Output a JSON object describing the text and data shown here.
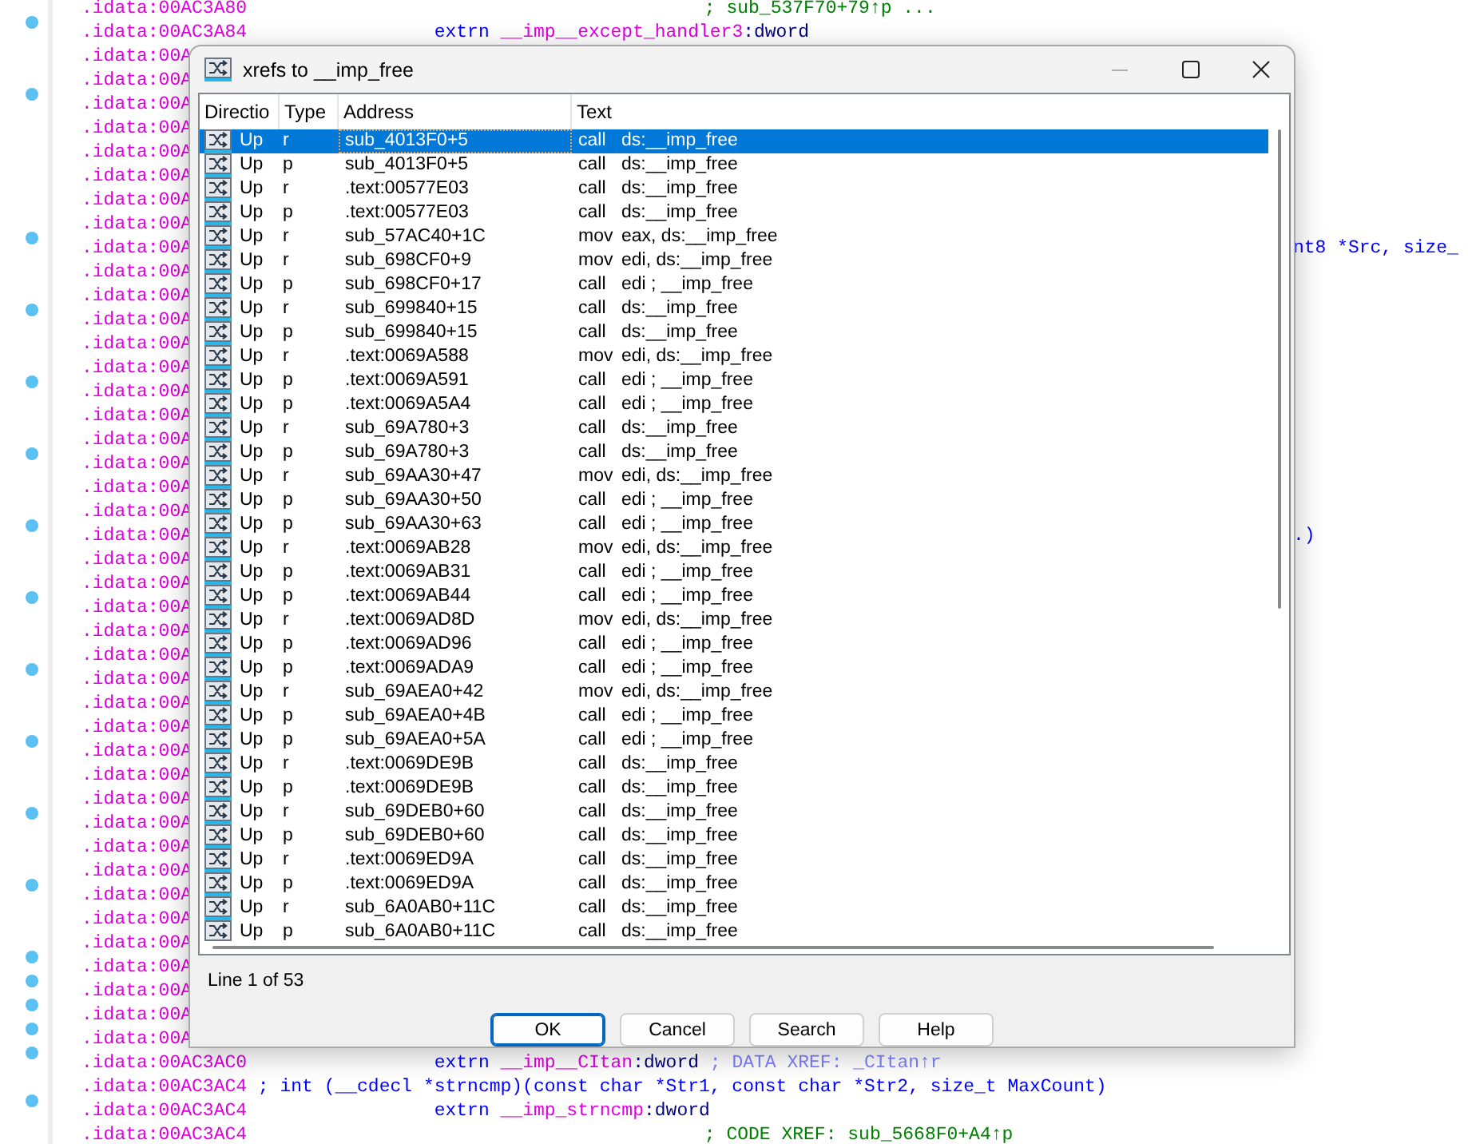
{
  "listing": [
    {
      "address": ".idata:00AC3A80",
      "marked": false,
      "parts": [
        {
          "text": "; sub_537F70+79↑p ...",
          "kind": "comment"
        }
      ]
    },
    {
      "address": ".idata:00AC3A84",
      "marked": true,
      "parts": [
        {
          "text": "extrn ",
          "kind": "keyword"
        },
        {
          "text": "__imp__except_handler3",
          "kind": "name"
        },
        {
          "text": ":dword",
          "kind": "type"
        }
      ]
    },
    {
      "address": ".idata:00A",
      "marked": false
    },
    {
      "address": ".idata:00A",
      "marked": false
    },
    {
      "address": ".idata:00A",
      "marked": true
    },
    {
      "address": ".idata:00A",
      "marked": false
    },
    {
      "address": ".idata:00A",
      "marked": false
    },
    {
      "address": ".idata:00A",
      "marked": false
    },
    {
      "address": ".idata:00A",
      "marked": false
    },
    {
      "address": ".idata:00A",
      "marked": false
    },
    {
      "address": ".idata:00A",
      "marked": true,
      "parts": [
        {
          "text": "nt8 *Src, size_",
          "kind": "tail"
        }
      ]
    },
    {
      "address": ".idata:00A",
      "marked": false
    },
    {
      "address": ".idata:00A",
      "marked": false
    },
    {
      "address": ".idata:00A",
      "marked": true
    },
    {
      "address": ".idata:00A",
      "marked": false
    },
    {
      "address": ".idata:00A",
      "marked": false
    },
    {
      "address": ".idata:00A",
      "marked": true
    },
    {
      "address": ".idata:00A",
      "marked": false
    },
    {
      "address": ".idata:00A",
      "marked": false
    },
    {
      "address": ".idata:00A",
      "marked": true
    },
    {
      "address": ".idata:00A",
      "marked": false
    },
    {
      "address": ".idata:00A",
      "marked": false
    },
    {
      "address": ".idata:00A",
      "marked": true,
      "parts": [
        {
          "text": ".)",
          "kind": "tail"
        }
      ]
    },
    {
      "address": ".idata:00A",
      "marked": false
    },
    {
      "address": ".idata:00A",
      "marked": false
    },
    {
      "address": ".idata:00A",
      "marked": true
    },
    {
      "address": ".idata:00A",
      "marked": false
    },
    {
      "address": ".idata:00A",
      "marked": false
    },
    {
      "address": ".idata:00A",
      "marked": true
    },
    {
      "address": ".idata:00A",
      "marked": false
    },
    {
      "address": ".idata:00A",
      "marked": false
    },
    {
      "address": ".idata:00A",
      "marked": true
    },
    {
      "address": ".idata:00A",
      "marked": false
    },
    {
      "address": ".idata:00A",
      "marked": false
    },
    {
      "address": ".idata:00A",
      "marked": true
    },
    {
      "address": ".idata:00A",
      "marked": false
    },
    {
      "address": ".idata:00A",
      "marked": false
    },
    {
      "address": ".idata:00A",
      "marked": true
    },
    {
      "address": ".idata:00A",
      "marked": false
    },
    {
      "address": ".idata:00A",
      "marked": false
    },
    {
      "address": ".idata:00A",
      "marked": true
    },
    {
      "address": ".idata:00A",
      "marked": true
    },
    {
      "address": ".idata:00A",
      "marked": true
    },
    {
      "address": ".idata:00A",
      "marked": true
    },
    {
      "address": ".idata:00AC3AC0",
      "marked": true,
      "parts": [
        {
          "text": "extrn ",
          "kind": "keyword"
        },
        {
          "text": "__imp__CItan",
          "kind": "name"
        },
        {
          "text": ":dword ",
          "kind": "type"
        },
        {
          "text": "; DATA XREF: _CItan↑r",
          "kind": "xref"
        }
      ]
    },
    {
      "address": ".idata:00AC3AC4",
      "marked": false,
      "parts": [
        {
          "text": "; int (__cdecl *strncmp)(const char *Str1, const char *Str2, size_t MaxCount)",
          "kind": "decl"
        }
      ]
    },
    {
      "address": ".idata:00AC3AC4",
      "marked": true,
      "parts": [
        {
          "text": "extrn ",
          "kind": "keyword"
        },
        {
          "text": "__imp_strncmp",
          "kind": "name"
        },
        {
          "text": ":dword",
          "kind": "type"
        }
      ]
    },
    {
      "address": ".idata:00AC3AC4",
      "marked": false,
      "parts": [
        {
          "text": "; CODE XREF: sub_5668F0+A4↑p",
          "kind": "comment"
        }
      ]
    }
  ],
  "dialog": {
    "title": "xrefs to __imp_free",
    "columns": [
      "Directio",
      "Type",
      "Address",
      "Text"
    ],
    "rows": [
      {
        "direction": "Up",
        "type": "r",
        "address": "sub_4013F0+5",
        "mnemonic": "call",
        "operand": "ds:__imp_free",
        "selected": true
      },
      {
        "direction": "Up",
        "type": "p",
        "address": "sub_4013F0+5",
        "mnemonic": "call",
        "operand": "ds:__imp_free",
        "selected": false
      },
      {
        "direction": "Up",
        "type": "r",
        "address": ".text:00577E03",
        "mnemonic": "call",
        "operand": "ds:__imp_free",
        "selected": false
      },
      {
        "direction": "Up",
        "type": "p",
        "address": ".text:00577E03",
        "mnemonic": "call",
        "operand": "ds:__imp_free",
        "selected": false
      },
      {
        "direction": "Up",
        "type": "r",
        "address": "sub_57AC40+1C",
        "mnemonic": "mov",
        "operand": "eax, ds:__imp_free",
        "selected": false
      },
      {
        "direction": "Up",
        "type": "r",
        "address": "sub_698CF0+9",
        "mnemonic": "mov",
        "operand": "edi, ds:__imp_free",
        "selected": false
      },
      {
        "direction": "Up",
        "type": "p",
        "address": "sub_698CF0+17",
        "mnemonic": "call",
        "operand": "edi ; __imp_free",
        "selected": false
      },
      {
        "direction": "Up",
        "type": "r",
        "address": "sub_699840+15",
        "mnemonic": "call",
        "operand": "ds:__imp_free",
        "selected": false
      },
      {
        "direction": "Up",
        "type": "p",
        "address": "sub_699840+15",
        "mnemonic": "call",
        "operand": "ds:__imp_free",
        "selected": false
      },
      {
        "direction": "Up",
        "type": "r",
        "address": ".text:0069A588",
        "mnemonic": "mov",
        "operand": "edi, ds:__imp_free",
        "selected": false
      },
      {
        "direction": "Up",
        "type": "p",
        "address": ".text:0069A591",
        "mnemonic": "call",
        "operand": "edi ; __imp_free",
        "selected": false
      },
      {
        "direction": "Up",
        "type": "p",
        "address": ".text:0069A5A4",
        "mnemonic": "call",
        "operand": "edi ; __imp_free",
        "selected": false
      },
      {
        "direction": "Up",
        "type": "r",
        "address": "sub_69A780+3",
        "mnemonic": "call",
        "operand": "ds:__imp_free",
        "selected": false
      },
      {
        "direction": "Up",
        "type": "p",
        "address": "sub_69A780+3",
        "mnemonic": "call",
        "operand": "ds:__imp_free",
        "selected": false
      },
      {
        "direction": "Up",
        "type": "r",
        "address": "sub_69AA30+47",
        "mnemonic": "mov",
        "operand": "edi, ds:__imp_free",
        "selected": false
      },
      {
        "direction": "Up",
        "type": "p",
        "address": "sub_69AA30+50",
        "mnemonic": "call",
        "operand": "edi ; __imp_free",
        "selected": false
      },
      {
        "direction": "Up",
        "type": "p",
        "address": "sub_69AA30+63",
        "mnemonic": "call",
        "operand": "edi ; __imp_free",
        "selected": false
      },
      {
        "direction": "Up",
        "type": "r",
        "address": ".text:0069AB28",
        "mnemonic": "mov",
        "operand": "edi, ds:__imp_free",
        "selected": false
      },
      {
        "direction": "Up",
        "type": "p",
        "address": ".text:0069AB31",
        "mnemonic": "call",
        "operand": "edi ; __imp_free",
        "selected": false
      },
      {
        "direction": "Up",
        "type": "p",
        "address": ".text:0069AB44",
        "mnemonic": "call",
        "operand": "edi ; __imp_free",
        "selected": false
      },
      {
        "direction": "Up",
        "type": "r",
        "address": ".text:0069AD8D",
        "mnemonic": "mov",
        "operand": "edi, ds:__imp_free",
        "selected": false
      },
      {
        "direction": "Up",
        "type": "p",
        "address": ".text:0069AD96",
        "mnemonic": "call",
        "operand": "edi ; __imp_free",
        "selected": false
      },
      {
        "direction": "Up",
        "type": "p",
        "address": ".text:0069ADA9",
        "mnemonic": "call",
        "operand": "edi ; __imp_free",
        "selected": false
      },
      {
        "direction": "Up",
        "type": "r",
        "address": "sub_69AEA0+42",
        "mnemonic": "mov",
        "operand": "edi, ds:__imp_free",
        "selected": false
      },
      {
        "direction": "Up",
        "type": "p",
        "address": "sub_69AEA0+4B",
        "mnemonic": "call",
        "operand": "edi ; __imp_free",
        "selected": false
      },
      {
        "direction": "Up",
        "type": "p",
        "address": "sub_69AEA0+5A",
        "mnemonic": "call",
        "operand": "edi ; __imp_free",
        "selected": false
      },
      {
        "direction": "Up",
        "type": "r",
        "address": ".text:0069DE9B",
        "mnemonic": "call",
        "operand": "ds:__imp_free",
        "selected": false
      },
      {
        "direction": "Up",
        "type": "p",
        "address": ".text:0069DE9B",
        "mnemonic": "call",
        "operand": "ds:__imp_free",
        "selected": false
      },
      {
        "direction": "Up",
        "type": "r",
        "address": "sub_69DEB0+60",
        "mnemonic": "call",
        "operand": "ds:__imp_free",
        "selected": false
      },
      {
        "direction": "Up",
        "type": "p",
        "address": "sub_69DEB0+60",
        "mnemonic": "call",
        "operand": "ds:__imp_free",
        "selected": false
      },
      {
        "direction": "Up",
        "type": "r",
        "address": ".text:0069ED9A",
        "mnemonic": "call",
        "operand": "ds:__imp_free",
        "selected": false
      },
      {
        "direction": "Up",
        "type": "p",
        "address": ".text:0069ED9A",
        "mnemonic": "call",
        "operand": "ds:__imp_free",
        "selected": false
      },
      {
        "direction": "Up",
        "type": "r",
        "address": "sub_6A0AB0+11C",
        "mnemonic": "call",
        "operand": "ds:__imp_free",
        "selected": false
      },
      {
        "direction": "Up",
        "type": "p",
        "address": "sub_6A0AB0+11C",
        "mnemonic": "call",
        "operand": "ds:__imp_free",
        "selected": false
      }
    ],
    "status": "Line 1 of 53",
    "buttons": [
      {
        "label": "OK",
        "default": true
      },
      {
        "label": "Cancel",
        "default": false
      },
      {
        "label": "Search",
        "default": false
      },
      {
        "label": "Help",
        "default": false
      }
    ]
  }
}
